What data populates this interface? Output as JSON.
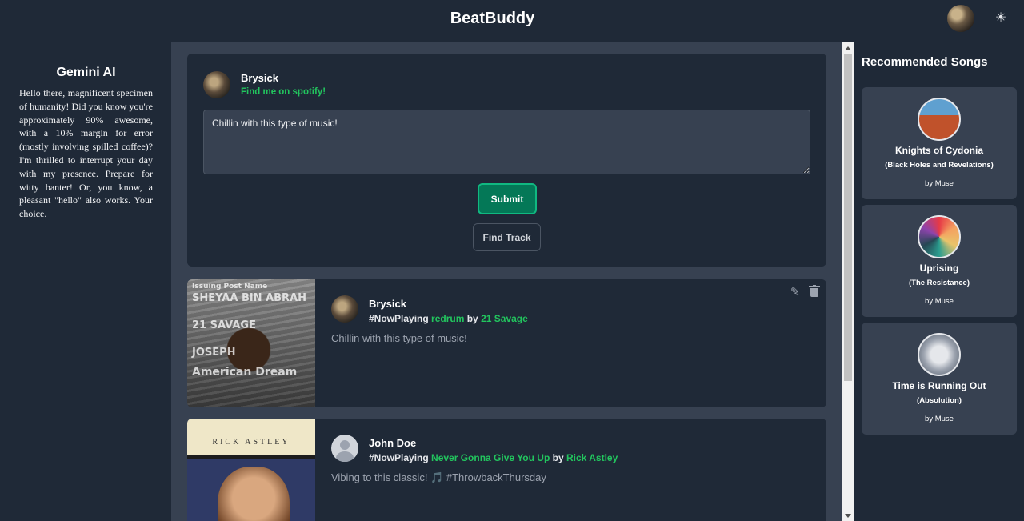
{
  "app": {
    "title": "BeatBuddy"
  },
  "header": {
    "avatar_icon": "user-avatar",
    "theme_icon": "sun-icon",
    "theme_glyph": "☀"
  },
  "gemini": {
    "title": "Gemini AI",
    "message": "Hello there, magnificent specimen of humanity! Did you know you're approximately 90% awesome, with a 10% margin for error (mostly involving spilled coffee)? I'm thrilled to interrupt your day with my presence. Prepare for witty banter! Or, you know, a pleasant \"hello\" also works. Your choice."
  },
  "composer": {
    "username": "Brysick",
    "spotify_link": "Find me on spotify!",
    "post_text": "Chillin with this type of music!",
    "submit_label": "Submit",
    "find_track_label": "Find Track"
  },
  "posts": [
    {
      "username": "Brysick",
      "hashtag": "#NowPlaying",
      "track": "redrum",
      "by": "by",
      "artist": "21 Savage",
      "content": "Chillin with this type of music!",
      "cover_lines": [
        "Issuing Post Name",
        "SHEYAA BIN ABRAH",
        "21 SAVAGE",
        "JOSEPH",
        "American Dream"
      ]
    },
    {
      "username": "John Doe",
      "hashtag": "#NowPlaying",
      "track": "Never Gonna Give You Up",
      "by": "by",
      "artist": "Rick Astley",
      "content_text": "Vibing to this classic!",
      "content_emoji": "🎵",
      "content_tag": "#ThrowbackThursday",
      "cover_artist": "RICK ASTLEY"
    }
  ],
  "recommended": {
    "title": "Recommended Songs",
    "songs": [
      {
        "song": "Knights of Cydonia",
        "album": "(Black Holes and Revelations)",
        "artist": "by Muse"
      },
      {
        "song": "Uprising",
        "album": "(The Resistance)",
        "artist": "by Muse"
      },
      {
        "song": "Time is Running Out",
        "album": "(Absolution)",
        "artist": "by Muse"
      }
    ]
  },
  "colors": {
    "accent_green": "#22c55e",
    "submit_bg": "#047857",
    "bg": "#1f2937",
    "panel": "#374151"
  }
}
